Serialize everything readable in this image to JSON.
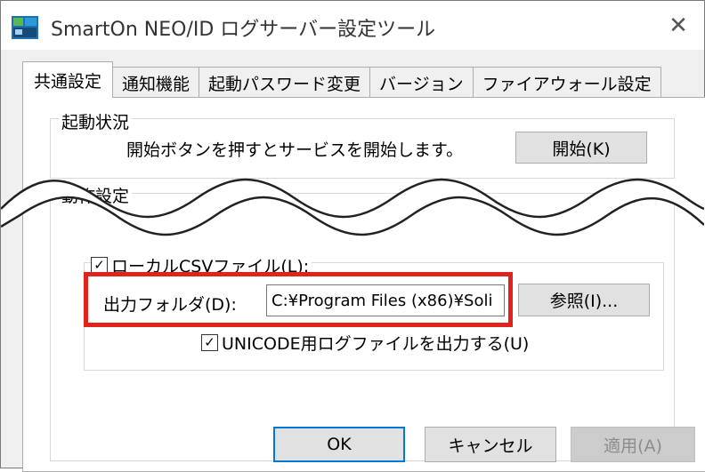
{
  "window": {
    "title": "SmartOn NEO/ID ログサーバー設定ツール",
    "close_glyph": "✕"
  },
  "tabs": [
    {
      "label": "共通設定",
      "active": true
    },
    {
      "label": "通知機能",
      "active": false
    },
    {
      "label": "起動パスワード変更",
      "active": false
    },
    {
      "label": "バージョン",
      "active": false
    },
    {
      "label": "ファイアウォール設定",
      "active": false
    }
  ],
  "startup_group": {
    "legend": "起動状況",
    "message": "開始ボタンを押すとサービスを開始します。",
    "start_button": "開始(K)"
  },
  "operation_group": {
    "legend": "動作設定"
  },
  "csv_group": {
    "checkbox_label": "ローカルCSVファイル(L):",
    "checkbox_checked": true,
    "output_folder_label": "出力フォルダ(D):",
    "output_folder_value": "C:¥Program Files (x86)¥Soli",
    "browse_button": "参照(I)...",
    "unicode_label": "UNICODE用ログファイルを出力する(U)",
    "unicode_checked": true
  },
  "footer": {
    "ok": "OK",
    "cancel": "キャンセル",
    "apply": "適用(A)"
  },
  "colors": {
    "highlight": "#e2231a",
    "dialog_bg": "#f0f0f0",
    "panel_bg": "#ffffff"
  }
}
